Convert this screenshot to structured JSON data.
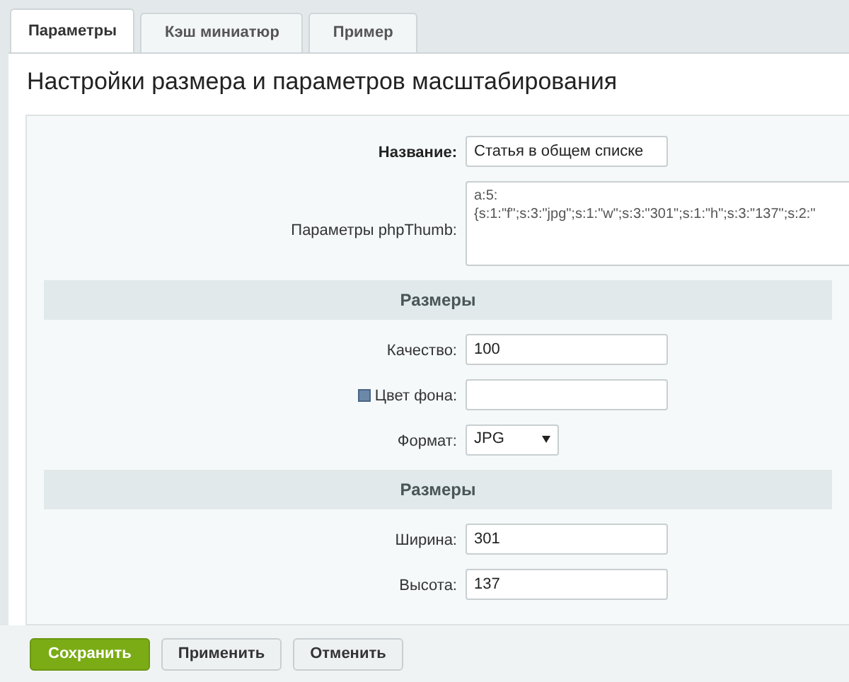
{
  "tabs": [
    {
      "label": "Параметры",
      "selected": true
    },
    {
      "label": "Кэш миниатюр",
      "selected": false
    },
    {
      "label": "Пример",
      "selected": false
    }
  ],
  "heading": "Настройки размера и параметров масштабирования",
  "form": [
    {
      "kind": "text",
      "label": "Название:",
      "bold": true,
      "value": "Статья в общем списке"
    },
    {
      "kind": "textarea",
      "label": "Параметры phpThumb:",
      "value": "a:5:\n{s:1:\"f\";s:3:\"jpg\";s:1:\"w\";s:3:\"301\";s:1:\"h\";s:3:\"137\";s:2:\""
    },
    {
      "kind": "section",
      "label": "Размеры"
    },
    {
      "kind": "text",
      "label": "Качество:",
      "value": "100"
    },
    {
      "kind": "text",
      "label": "Цвет фона:",
      "help": true
    },
    {
      "kind": "select",
      "label": "Формат:",
      "value": "JPG"
    },
    {
      "kind": "section",
      "label": "Размеры"
    },
    {
      "kind": "text",
      "label": "Ширина:",
      "value": "301"
    },
    {
      "kind": "text",
      "label": "Высота:",
      "value": "137"
    }
  ],
  "buttons": [
    {
      "label": "Сохранить",
      "primary": true
    },
    {
      "label": "Применить",
      "primary": false
    },
    {
      "label": "Отменить",
      "primary": false
    }
  ]
}
